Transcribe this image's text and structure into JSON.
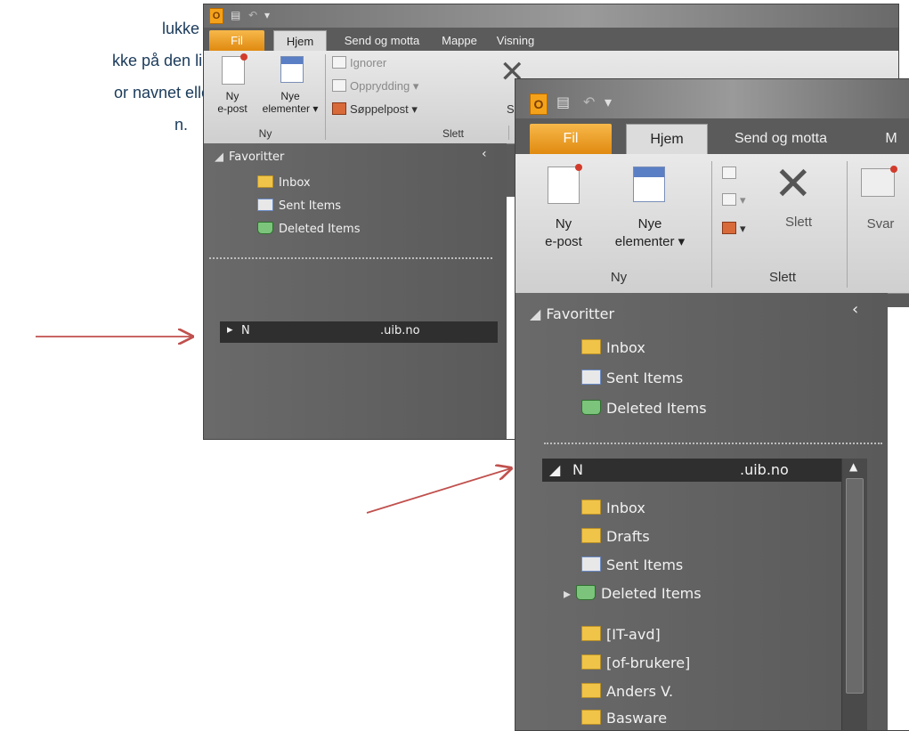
{
  "doc_lines": [
    "lukke et sett",
    "kke på den lille",
    "or navnet eller",
    "n."
  ],
  "arrow_color": "#c0504d",
  "window1": {
    "logo": "O",
    "quick_access": "▾",
    "tabs": [
      "Fil",
      "Hjem",
      "Send og motta",
      "Mappe",
      "Visning"
    ],
    "buttons": {
      "new_email_l1": "Ny",
      "new_email_l2": "e-post",
      "new_items_l1": "Nye",
      "new_items_l2": "elementer ▾",
      "ignore": "Ignorer",
      "cleanup": "Opprydding ▾",
      "junk": "Søppelpost ▾",
      "cut": "S"
    },
    "groups": {
      "new": "Ny",
      "delete": "Slett"
    },
    "nav": {
      "favorites": "Favoritter",
      "collapse": "‹",
      "items": [
        "Inbox",
        "Sent Items",
        "Deleted Items"
      ],
      "account_prefix": "N",
      "account_domain": ".uib.no"
    }
  },
  "window2": {
    "logo": "O",
    "quick_access": "▾",
    "tabs": [
      "Fil",
      "Hjem",
      "Send og motta",
      "M"
    ],
    "buttons": {
      "new_email_l1": "Ny",
      "new_email_l2": "e-post",
      "new_items_l1": "Nye",
      "new_items_l2": "elementer ▾",
      "delete": "Slett",
      "reply": "Svar"
    },
    "groups": {
      "new": "Ny",
      "delete": "Slett"
    },
    "nav": {
      "favorites": "Favoritter",
      "collapse": "‹",
      "fav_items": [
        "Inbox",
        "Sent Items",
        "Deleted Items"
      ],
      "account_prefix": "N",
      "account_domain": ".uib.no",
      "account_items": [
        "Inbox",
        "Drafts",
        "Sent Items",
        "Deleted Items",
        "[IT-avd]",
        "[of-brukere]",
        "Anders V.",
        "Basware"
      ]
    }
  }
}
